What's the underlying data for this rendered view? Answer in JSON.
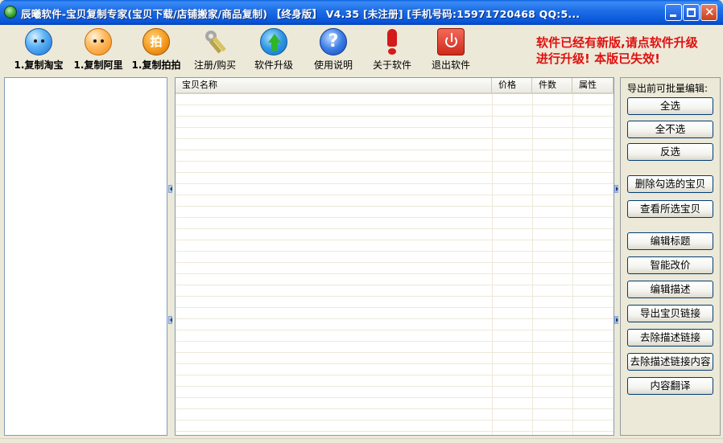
{
  "window": {
    "title": "辰曦软件-宝贝复制专家(宝贝下载/店铺搬家/商品复制) 【终身版】 V4.35 [未注册] [手机号码:15971720468  QQ:5...",
    "minimize_icon": "minimize-icon",
    "maximize_icon": "maximize-icon",
    "close_glyph": "✕"
  },
  "toolbar": {
    "items": [
      {
        "label": "1.复制淘宝",
        "icon": "taobao-icon"
      },
      {
        "label": "1.复制阿里",
        "icon": "alibaba-icon"
      },
      {
        "label": "1.复制拍拍",
        "icon": "paipai-icon",
        "glyph": "拍"
      },
      {
        "label": "注册/购买",
        "icon": "key-icon"
      },
      {
        "label": "软件升级",
        "icon": "upgrade-icon"
      },
      {
        "label": "使用说明",
        "icon": "help-icon",
        "glyph": "?"
      },
      {
        "label": "关于软件",
        "icon": "about-icon"
      },
      {
        "label": "退出软件",
        "icon": "exit-icon"
      }
    ]
  },
  "notice": {
    "line1": "软件已经有新版,请点软件升级",
    "line2": "进行升级! 本版已失效!",
    "color": "#e01010"
  },
  "table": {
    "columns": [
      "宝贝名称",
      "价格",
      "件数",
      "属性"
    ],
    "rows": []
  },
  "rightpanel": {
    "header": "导出前可批量编辑:",
    "buttons": {
      "select_all": "全选",
      "select_none": "全不选",
      "invert": "反选",
      "delete_checked": "删除勾选的宝贝",
      "view_selected": "查看所选宝贝",
      "edit_title": "编辑标题",
      "smart_price": "智能改价",
      "edit_desc": "编辑描述",
      "export_links": "导出宝贝链接",
      "remove_desc_links": "去除描述链接",
      "remove_desc_link_content": "去除描述链接内容",
      "translate": "内容翻译"
    }
  }
}
